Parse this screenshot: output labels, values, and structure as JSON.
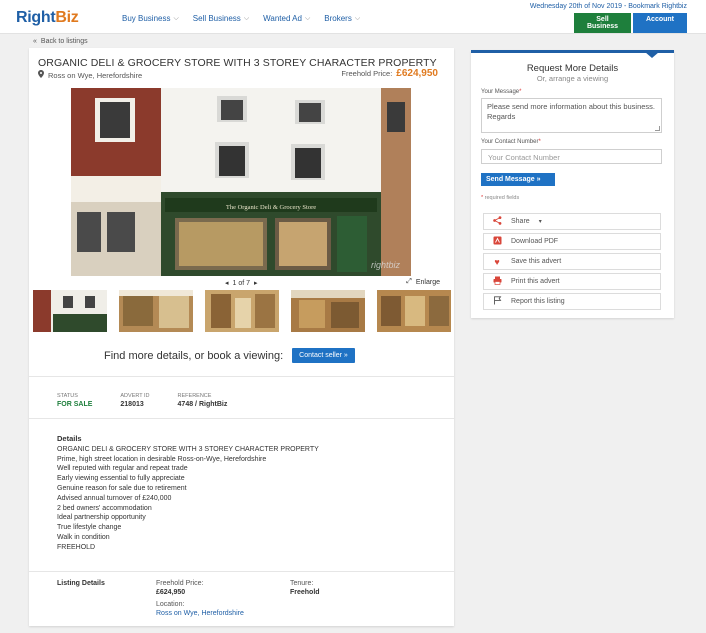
{
  "header": {
    "logo_right": "Right",
    "logo_biz": "Biz",
    "nav": [
      {
        "label": "Buy Business"
      },
      {
        "label": "Sell Business"
      },
      {
        "label": "Wanted Ad"
      },
      {
        "label": "Brokers"
      }
    ],
    "date_text": "Wednesday 20th of Nov 2019 - Bookmark Rightbiz",
    "sell_button": "Sell Business",
    "account_button": "Account"
  },
  "back_link": "Back to listings",
  "listing": {
    "title": "ORGANIC DELI & GROCERY STORE WITH 3 STOREY CHARACTER PROPERTY",
    "location": "Ross on Wye, Herefordshire",
    "price_label": "Freehold Price:",
    "price_value": "£624,950",
    "photo_counter": "1 of 7",
    "enlarge_label": "Enlarge",
    "shopfront_sign": "The Organic Deli & Grocery Store",
    "watermark": "rightbiz",
    "find_more_text": "Find more details, or book a viewing:",
    "contact_button": "Contact seller »"
  },
  "meta": {
    "status_label": "STATUS",
    "status_value": "FOR SALE",
    "advert_label": "ADVERT ID",
    "advert_value": "218013",
    "reference_label": "REFERENCE",
    "reference_value": "4748 / RightBiz"
  },
  "details": {
    "heading": "Details",
    "lines": [
      "ORGANIC DELI & GROCERY STORE WITH 3 STOREY CHARACTER PROPERTY",
      "Prime, high street location in desirable Ross-on-Wye, Herefordshire",
      "Well reputed with regular and repeat trade",
      "Early viewing essential to fully appreciate",
      "Genuine reason for sale due to retirement",
      "Advised annual turnover of £240,000",
      "2 bed owners' accommodation",
      "Ideal partnership opportunity",
      "True lifestyle change",
      "Walk in condition",
      "FREEHOLD"
    ]
  },
  "listing_details": {
    "label": "Listing Details",
    "freehold_label": "Freehold Price:",
    "freehold_value": "£624,950",
    "tenure_label": "Tenure:",
    "tenure_value": "Freehold",
    "location_label": "Location:",
    "location_value": "Ross on Wye, Herefordshire"
  },
  "sidebar": {
    "title": "Request More Details",
    "subtitle": "Or, arrange a viewing",
    "message_label": "Your Message",
    "message_value": "Please send more information about this business. Regards",
    "contact_label": "Your Contact Number",
    "contact_placeholder": "Your Contact Number",
    "send_button": "Send Message »",
    "required_note": "required fields",
    "actions": [
      {
        "label": "Share",
        "icon": "share-icon"
      },
      {
        "label": "Download PDF",
        "icon": "pdf-icon"
      },
      {
        "label": "Save this advert",
        "icon": "heart-icon"
      },
      {
        "label": "Print this advert",
        "icon": "printer-icon"
      },
      {
        "label": "Report this listing",
        "icon": "flag-icon"
      }
    ]
  },
  "colors": {
    "brand_blue": "#1f5fa6",
    "button_blue": "#1f72c4",
    "sell_green": "#1e7f3c",
    "price_orange": "#e07a1f"
  }
}
